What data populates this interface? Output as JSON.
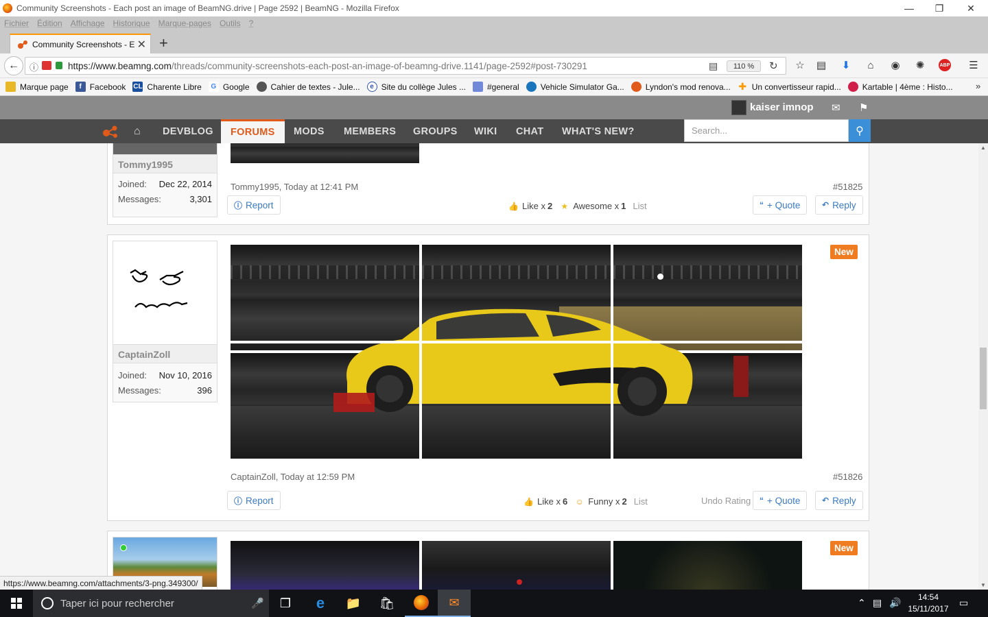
{
  "window": {
    "title": "Community Screenshots - Each post an image of BeamNG.drive | Page 2592 | BeamNG - Mozilla Firefox"
  },
  "menubar": [
    "Fichier",
    "Édition",
    "Affichage",
    "Historique",
    "Marque-pages",
    "Outils",
    "?"
  ],
  "tab": {
    "label": "Community Screenshots - E",
    "newtab": "+"
  },
  "navbar": {
    "url_host": "https://www.beamng.com",
    "url_path": "/threads/community-screenshots-each-post-an-image-of-beamng-drive.1141/page-2592#post-730291",
    "zoom": "110 %"
  },
  "bookmarks": [
    {
      "label": "Marque page",
      "icon": "folder-icon",
      "color": "#e8b828"
    },
    {
      "label": "Facebook",
      "icon": "facebook-icon",
      "color": "#3b5998"
    },
    {
      "label": "Charente Libre",
      "icon": "charente-libre-icon",
      "color": "#1a4fa0"
    },
    {
      "label": "Google",
      "icon": "google-icon",
      "color": "#4285f4"
    },
    {
      "label": "Cahier de textes - Jule...",
      "icon": "globe-icon",
      "color": "#555555"
    },
    {
      "label": "Site du collège Jules ...",
      "icon": "site-icon",
      "color": "#3355aa"
    },
    {
      "label": "#general",
      "icon": "discord-icon",
      "color": "#7289da"
    },
    {
      "label": "Vehicle Simulator Ga...",
      "icon": "steam-icon",
      "color": "#1b75bc"
    },
    {
      "label": "Lyndon's mod renova...",
      "icon": "beamng-icon",
      "color": "#e05a1a"
    },
    {
      "label": "Un convertisseur rapid...",
      "icon": "converter-icon",
      "color": "#ff9900"
    },
    {
      "label": "Kartable | 4ème : Histo...",
      "icon": "kartable-icon",
      "color": "#d0204a"
    }
  ],
  "site": {
    "username": "kaiser imnop",
    "nav": [
      "DEVBLOG",
      "FORUMS",
      "MODS",
      "MEMBERS",
      "GROUPS",
      "WIKI",
      "CHAT",
      "WHAT'S NEW?"
    ],
    "search_placeholder": "Search..."
  },
  "posts": [
    {
      "author": "Tommy1995",
      "joined_label": "Joined:",
      "joined": "Dec 22, 2014",
      "messages_label": "Messages:",
      "messages": "3,301",
      "meta": "Tommy1995, Today at 12:41 PM",
      "number": "#51825",
      "report": "Report",
      "ratings": [
        {
          "name": "Like x",
          "count": "2",
          "icon": "thumbs-up-icon"
        },
        {
          "name": "Awesome x",
          "count": "1",
          "icon": "star-icon"
        }
      ],
      "list": "List",
      "quote": "+ Quote",
      "reply": "Reply"
    },
    {
      "author": "CaptainZoll",
      "joined_label": "Joined:",
      "joined": "Nov 10, 2016",
      "messages_label": "Messages:",
      "messages": "396",
      "meta": "CaptainZoll, Today at 12:59 PM",
      "number": "#51826",
      "badge": "New",
      "report": "Report",
      "ratings": [
        {
          "name": "Like x",
          "count": "6",
          "icon": "thumbs-up-icon"
        },
        {
          "name": "Funny x",
          "count": "2",
          "icon": "laugh-icon"
        }
      ],
      "list": "List",
      "undo": "Undo Rating",
      "quote": "+ Quote",
      "reply": "Reply"
    },
    {
      "badge": "New"
    }
  ],
  "status_url": "https://www.beamng.com/attachments/3-png.349300/",
  "taskbar": {
    "search": "Taper ici pour rechercher",
    "time": "14:54",
    "date": "15/11/2017"
  }
}
